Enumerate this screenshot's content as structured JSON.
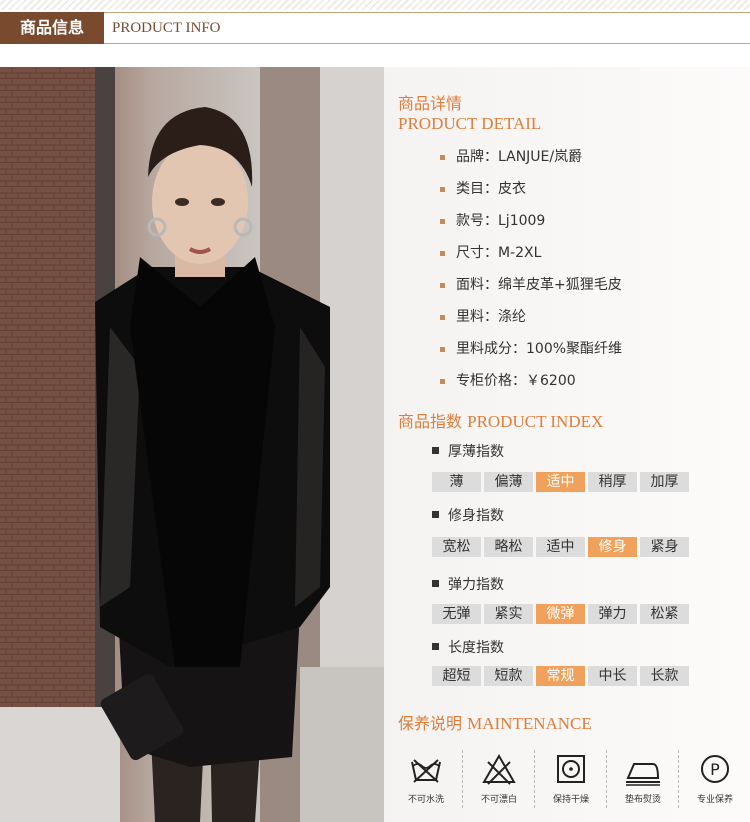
{
  "header": {
    "title_cn": "商品信息",
    "title_en": "PRODUCT INFO"
  },
  "detail": {
    "title_cn": "商品详情",
    "title_en": "PRODUCT DETAIL",
    "items": [
      "品牌：LANJUE/岚爵",
      "类目：皮衣",
      "款号：Lj1009",
      "尺寸：M-2XL",
      "面料：绵羊皮革+狐狸毛皮",
      "里料：涤纶",
      "里料成分：100%聚酯纤维",
      "专柜价格：￥6200"
    ]
  },
  "index": {
    "title_cn": "商品指数",
    "title_en": "PRODUCT INDEX",
    "groups": [
      {
        "label": "厚薄指数",
        "options": [
          "薄",
          "偏薄",
          "适中",
          "稍厚",
          "加厚"
        ],
        "selected": "适中"
      },
      {
        "label": "修身指数",
        "options": [
          "宽松",
          "略松",
          "适中",
          "修身",
          "紧身"
        ],
        "selected": "修身"
      },
      {
        "label": "弹力指数",
        "options": [
          "无弹",
          "紧实",
          "微弹",
          "弹力",
          "松紧"
        ],
        "selected": "微弹"
      },
      {
        "label": "长度指数",
        "options": [
          "超短",
          "短款",
          "常规",
          "中长",
          "长款"
        ],
        "selected": "常规"
      }
    ]
  },
  "maintenance": {
    "title_cn": "保养说明",
    "title_en": "MAINTENANCE",
    "items": [
      {
        "icon": "no-wash-icon",
        "label": "不可水洗"
      },
      {
        "icon": "no-bleach-icon",
        "label": "不可漂白"
      },
      {
        "icon": "dry-flat-icon",
        "label": "保持干燥"
      },
      {
        "icon": "iron-with-cloth-icon",
        "label": "垫布熨烫"
      },
      {
        "icon": "professional-care-icon",
        "label": "专业保养"
      }
    ]
  },
  "colors": {
    "accent": "#e07d3b",
    "header_bg": "#7a4a2e",
    "selected": "#f0a25c",
    "unselected": "#dcdcdc"
  }
}
